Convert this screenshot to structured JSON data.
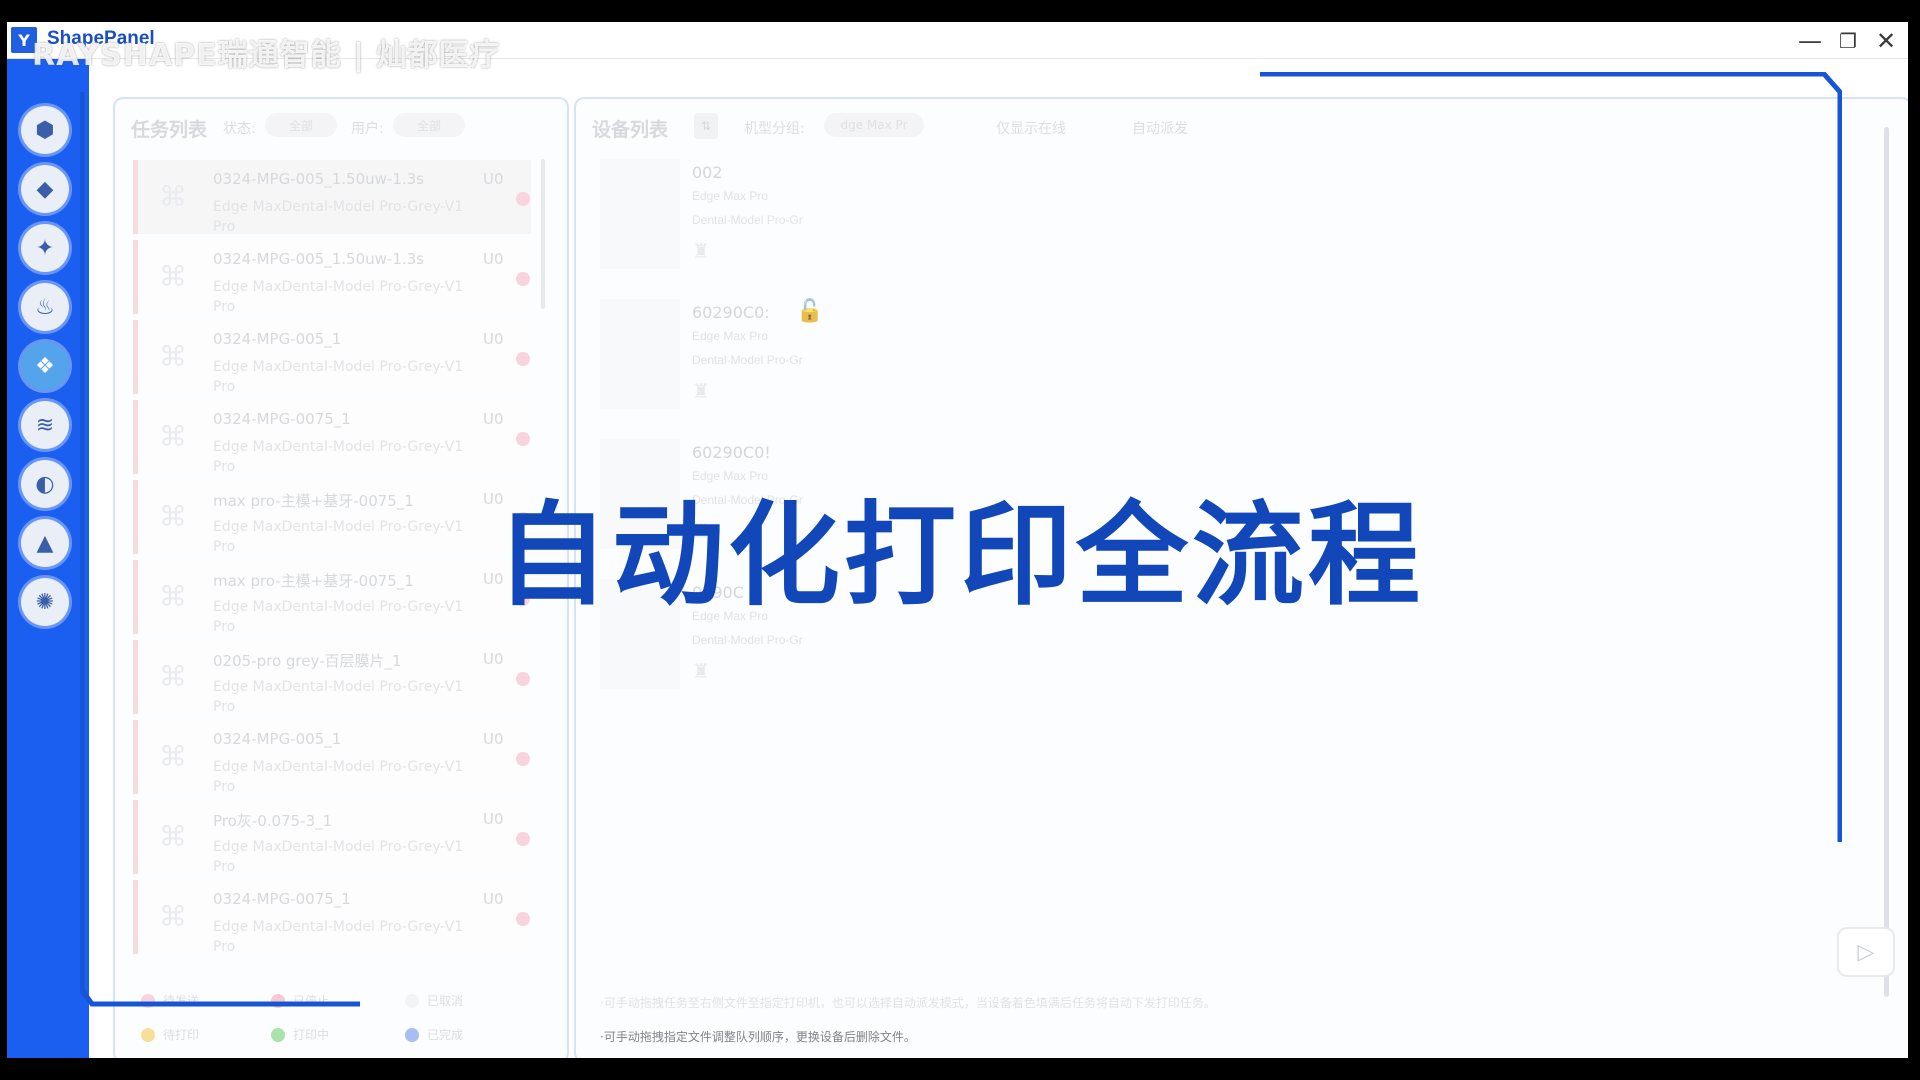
{
  "window": {
    "title": "ShapePanel",
    "logo_glyph": "Y",
    "watermark": "RAYSHAPE瑞通智能 | 灿都医疗",
    "controls": {
      "minimize": "—",
      "restore": "❐",
      "close": "✕"
    }
  },
  "colors": {
    "accent": "#1a5ff0",
    "overlay_text": "#1147b8",
    "status_waiting": "#f7c5d3",
    "sidebar_active": "#53a4ea"
  },
  "sidebar": {
    "items": [
      {
        "icon": "printer-icon",
        "glyph": "⬢"
      },
      {
        "icon": "cube-icon",
        "glyph": "◆"
      },
      {
        "icon": "model-icon",
        "glyph": "✦"
      },
      {
        "icon": "resin-drop-icon",
        "glyph": "♨"
      },
      {
        "icon": "print-job-icon",
        "glyph": "❖"
      },
      {
        "icon": "layers-icon",
        "glyph": "≋"
      },
      {
        "icon": "gear-refresh-icon",
        "glyph": "◐"
      },
      {
        "icon": "upload-icon",
        "glyph": "▲"
      },
      {
        "icon": "settings-icon",
        "glyph": "✺"
      }
    ],
    "active_index": 4
  },
  "task_panel": {
    "title": "任务列表",
    "status_label": "状态:",
    "status_value": "全部",
    "user_label": "用户:",
    "user_value": "全部",
    "tasks": [
      {
        "name": "0324-MPG-005_1.50uw-1.3s",
        "user": "U0",
        "model": "Edge Max",
        "material": "Dental-Model Pro-Grey-V1",
        "material_tail": "Pro"
      },
      {
        "name": "0324-MPG-005_1.50uw-1.3s",
        "user": "U0",
        "model": "Edge Max",
        "material": "Dental-Model Pro-Grey-V1",
        "material_tail": "Pro"
      },
      {
        "name": "0324-MPG-005_1",
        "user": "U0",
        "model": "Edge Max",
        "material": "Dental-Model Pro-Grey-V1",
        "material_tail": "Pro"
      },
      {
        "name": "0324-MPG-0075_1",
        "user": "U0",
        "model": "Edge Max",
        "material": "Dental-Model Pro-Grey-V1",
        "material_tail": "Pro"
      },
      {
        "name": "max pro-主模+基牙-0075_1",
        "user": "U0",
        "model": "Edge Max",
        "material": "Dental-Model Pro-Grey-V1",
        "material_tail": "Pro"
      },
      {
        "name": "max pro-主模+基牙-0075_1",
        "user": "U0",
        "model": "Edge Max",
        "material": "Dental-Model Pro-Grey-V1",
        "material_tail": "Pro"
      },
      {
        "name": "0205-pro grey-百层膜片_1",
        "user": "U0",
        "model": "Edge Max",
        "material": "Dental-Model Pro-Grey-V1",
        "material_tail": "Pro"
      },
      {
        "name": "0324-MPG-005_1",
        "user": "U0",
        "model": "Edge Max",
        "material": "Dental-Model Pro-Grey-V1",
        "material_tail": "Pro"
      },
      {
        "name": "Pro灰-0.075-3_1",
        "user": "U0",
        "model": "Edge Max",
        "material": "Dental-Model Pro-Grey-V1",
        "material_tail": "Pro"
      },
      {
        "name": "0324-MPG-0075_1",
        "user": "U0",
        "model": "Edge Max",
        "material": "Dental-Model Pro-Grey-V1",
        "material_tail": "Pro"
      }
    ],
    "legend": [
      {
        "label": "待发送",
        "color": "#f7c5d3"
      },
      {
        "label": "已停止",
        "color": "#f6b7c2"
      },
      {
        "label": "已取消",
        "color": "#eef0f2"
      },
      {
        "label": "待打印",
        "color": "#f5d37a"
      },
      {
        "label": "打印中",
        "color": "#8fd88f"
      },
      {
        "label": "已完成",
        "color": "#8aa8f0"
      }
    ]
  },
  "device_panel": {
    "title": "设备列表",
    "sort_glyph": "⇅",
    "model_filter_label": "机型分组:",
    "model_filter_value": "dge Max Pr",
    "online_label": "仅显示在线",
    "auto_dispatch_label": "自动派发",
    "devices": [
      {
        "id": "002",
        "model": "Edge Max Pro",
        "material": "Dental-Model Pro-Gr",
        "locked": false
      },
      {
        "id": "60290C0:",
        "model": "Edge Max Pro",
        "material": "Dental-Model Pro-Gr",
        "locked": true
      },
      {
        "id": "60290C0!",
        "model": "Edge Max Pro",
        "material": "Dental-Model Pro-Gr",
        "locked": false
      },
      {
        "id": "0290C",
        "model": "Edge Max Pro",
        "material": "Dental-Model Pro-Gr",
        "locked": false
      }
    ],
    "lock_glyph": "🔓",
    "status_glyph": "♜",
    "hint_1": "·可手动拖拽任务至右侧文件至指定打印机，也可以选择自动派发模式，当设备着色填满后任务将自动下发打印任务。",
    "hint_2": "·可手动拖拽指定文件调整队列顺序，更换设备后删除文件。",
    "play_glyph": "▷"
  },
  "overlay": {
    "title": "自动化打印全流程"
  }
}
